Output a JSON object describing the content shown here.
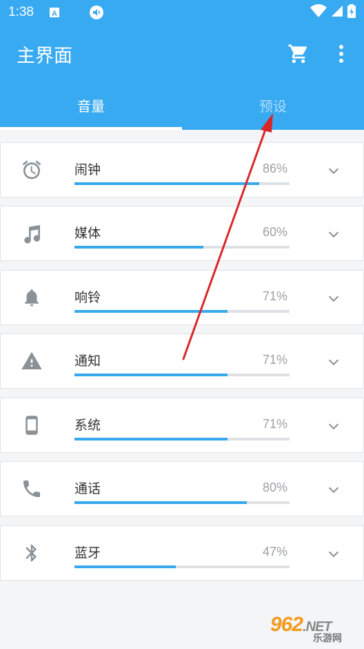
{
  "status_bar": {
    "time": "1:38",
    "icons": [
      "keyboard-a-icon",
      "volume-notification-icon",
      "wifi-icon",
      "signal-icon",
      "battery-charging-icon"
    ]
  },
  "app_bar": {
    "title": "主界面",
    "actions": [
      "cart-icon",
      "more-vert-icon"
    ]
  },
  "tabs": [
    {
      "label": "音量",
      "active": true
    },
    {
      "label": "预设",
      "active": false
    }
  ],
  "volumes": [
    {
      "label": "闹钟",
      "percent_text": "86%",
      "level": 0.86,
      "icon": "alarm-icon"
    },
    {
      "label": "媒体",
      "percent_text": "60%",
      "level": 0.6,
      "icon": "music-note-icon"
    },
    {
      "label": "响铃",
      "percent_text": "71%",
      "level": 0.71,
      "icon": "bell-icon"
    },
    {
      "label": "通知",
      "percent_text": "71%",
      "level": 0.71,
      "icon": "warning-icon"
    },
    {
      "label": "系统",
      "percent_text": "71%",
      "level": 0.71,
      "icon": "phone-device-icon"
    },
    {
      "label": "通话",
      "percent_text": "80%",
      "level": 0.8,
      "icon": "call-icon"
    },
    {
      "label": "蓝牙",
      "percent_text": "47%",
      "level": 0.47,
      "icon": "bluetooth-icon"
    }
  ],
  "watermark": {
    "brand": "962",
    "suffix": ".NET",
    "subtitle": "乐游网"
  },
  "colors": {
    "primary": "#38aaf2",
    "bar_fill": "#36a9ed",
    "bar_track": "#dde1e4",
    "icon_gray": "#8a9197",
    "annotation_arrow": "#d9262b"
  }
}
